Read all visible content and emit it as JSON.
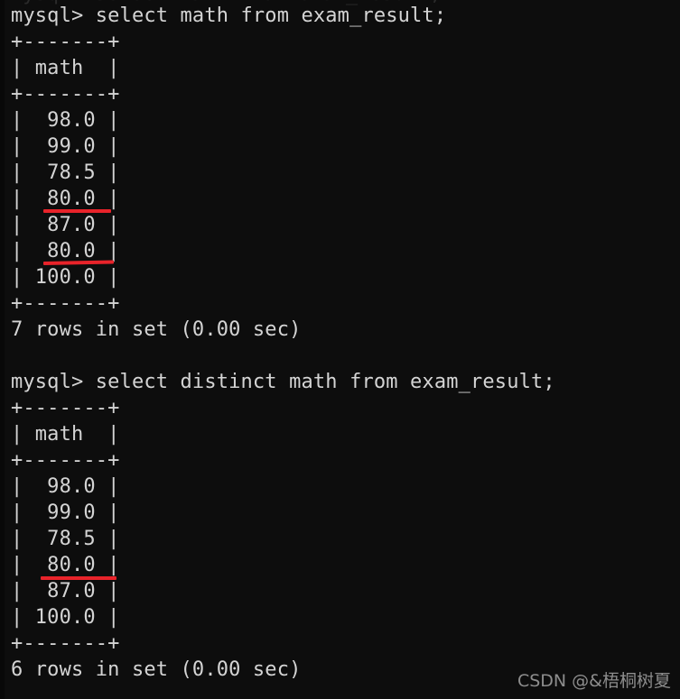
{
  "terminal": {
    "background_color": "#0d0d0d",
    "text_color": "#d4d4d4",
    "annotation_color": "#e8232a",
    "top_clipped_line": "mysql> select math from exam_result;"
  },
  "blocks": [
    {
      "prompt": "mysql> ",
      "command": "select math from exam_result;",
      "prompt_line": "mysql> select math from exam_result;",
      "table": {
        "top_border": "+-------+",
        "header_row": "| math  |",
        "header_separator": "+-------+",
        "column_header": "math",
        "rows": [
          "|  98.0 |",
          "|  99.0 |",
          "|  78.5 |",
          "|  80.0 |",
          "|  87.0 |",
          "|  80.0 |",
          "| 100.0 |"
        ],
        "values": [
          "98.0",
          "99.0",
          "78.5",
          "80.0",
          "87.0",
          "80.0",
          "100.0"
        ],
        "bottom_border": "+-------+"
      },
      "status": "7 rows in set (0.00 sec)",
      "row_count": 7,
      "duration": "0.00 sec"
    },
    {
      "prompt": "mysql> ",
      "command": "select distinct math from exam_result;",
      "prompt_line": "mysql> select distinct math from exam_result;",
      "table": {
        "top_border": "+-------+",
        "header_row": "| math  |",
        "header_separator": "+-------+",
        "column_header": "math",
        "rows": [
          "|  98.0 |",
          "|  99.0 |",
          "|  78.5 |",
          "|  80.0 |",
          "|  87.0 |",
          "| 100.0 |"
        ],
        "values": [
          "98.0",
          "99.0",
          "78.5",
          "80.0",
          "87.0",
          "100.0"
        ],
        "bottom_border": "+-------+"
      },
      "status": "6 rows in set (0.00 sec)",
      "row_count": 6,
      "duration": "0.00 sec"
    }
  ],
  "annotations": [
    {
      "id": "underline-1",
      "target_value": "80.0",
      "block": 1,
      "row_index": 3
    },
    {
      "id": "underline-2",
      "target_value": "80.0",
      "block": 1,
      "row_index": 5
    },
    {
      "id": "underline-3",
      "target_value": "80.0",
      "block": 2,
      "row_index": 3
    }
  ],
  "watermark": {
    "text": "CSDN @&梧桐树夏"
  },
  "blank_line": " "
}
